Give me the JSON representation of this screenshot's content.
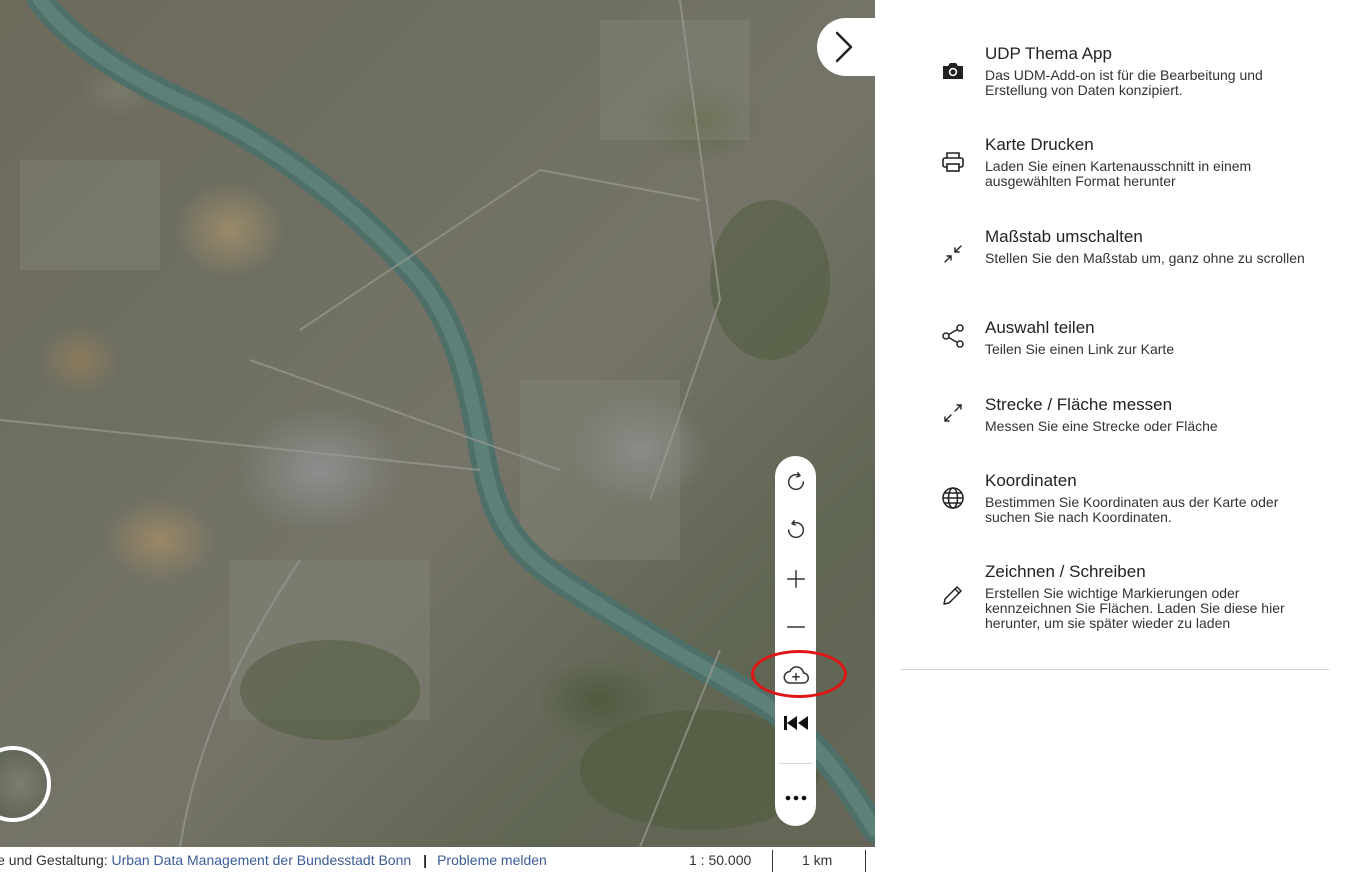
{
  "map": {
    "toolbar": [
      {
        "name": "rotate-clockwise",
        "icon": "rotate-cw-icon"
      },
      {
        "name": "rotate-counterclockwise",
        "icon": "rotate-ccw-icon"
      },
      {
        "name": "zoom-in",
        "icon": "plus-icon"
      },
      {
        "name": "zoom-out",
        "icon": "minus-icon"
      },
      {
        "name": "add-layer",
        "icon": "cloud-plus-icon"
      },
      {
        "name": "previous-view",
        "icon": "skip-back-icon"
      },
      {
        "name": "more",
        "icon": "more-horizontal-icon"
      }
    ],
    "highlight_color": "#e01515"
  },
  "footer": {
    "credits_prefix": "ie und Gestaltung: ",
    "credits_link": "Urban Data Management der Bundesstadt Bonn",
    "separator": "|",
    "report_link": "Probleme melden",
    "scale": "1 : 50.000",
    "distance": "1 km"
  },
  "menu": [
    {
      "icon": "camera-icon",
      "title": "UDP Thema App",
      "description": "Das UDM-Add-on ist für die Bearbeitung und Erstellung von Daten konzipiert."
    },
    {
      "icon": "printer-icon",
      "title": "Karte Drucken",
      "description": "Laden Sie einen Kartenausschnitt in einem ausgewählten Format herunter"
    },
    {
      "icon": "minimize-icon",
      "title": "Maßstab umschalten",
      "description": "Stellen Sie den Maßstab um, ganz ohne zu scrollen"
    },
    {
      "icon": "share-icon",
      "title": "Auswahl teilen",
      "description": "Teilen Sie einen Link zur Karte"
    },
    {
      "icon": "maximize-icon",
      "title": "Strecke / Fläche messen",
      "description": "Messen Sie eine Strecke oder Fläche"
    },
    {
      "icon": "globe-icon",
      "title": "Koordinaten",
      "description": "Bestimmen Sie Koordinaten aus der Karte oder suchen Sie nach Koordinaten."
    },
    {
      "icon": "pencil-icon",
      "title": "Zeichnen / Schreiben",
      "description": "Erstellen Sie wichtige Markierungen oder kennzeichnen Sie Flächen. Laden Sie diese hier herunter, um sie später wieder zu laden"
    }
  ]
}
